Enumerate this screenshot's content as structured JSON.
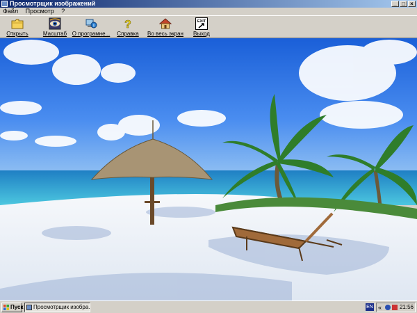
{
  "window": {
    "title": "Просмотрщик изображений",
    "controls": {
      "minimize": "_",
      "maximize": "□",
      "close": "×"
    }
  },
  "menu": {
    "items": [
      {
        "label": "Файл"
      },
      {
        "label": "Просмотр"
      },
      {
        "label": "?"
      }
    ]
  },
  "toolbar": {
    "buttons": [
      {
        "label": "Открыть",
        "icon": "folder-icon"
      },
      {
        "label": "Масштаб",
        "icon": "eye-icon"
      },
      {
        "label": "О програмне...",
        "icon": "info-icon"
      },
      {
        "label": "Справка",
        "icon": "help-icon"
      },
      {
        "label": "Во весь экран",
        "icon": "home-icon"
      },
      {
        "label": "Выход",
        "icon": "exit-icon"
      }
    ],
    "exit_badge": "EXIT"
  },
  "viewer": {
    "image_subject": "tropical-beach-photo"
  },
  "taskbar": {
    "start_label": "Пуск",
    "task_label": "Просмотрщик изобра...",
    "language": "EN",
    "tray_chevron": "«",
    "clock": "21:56"
  }
}
